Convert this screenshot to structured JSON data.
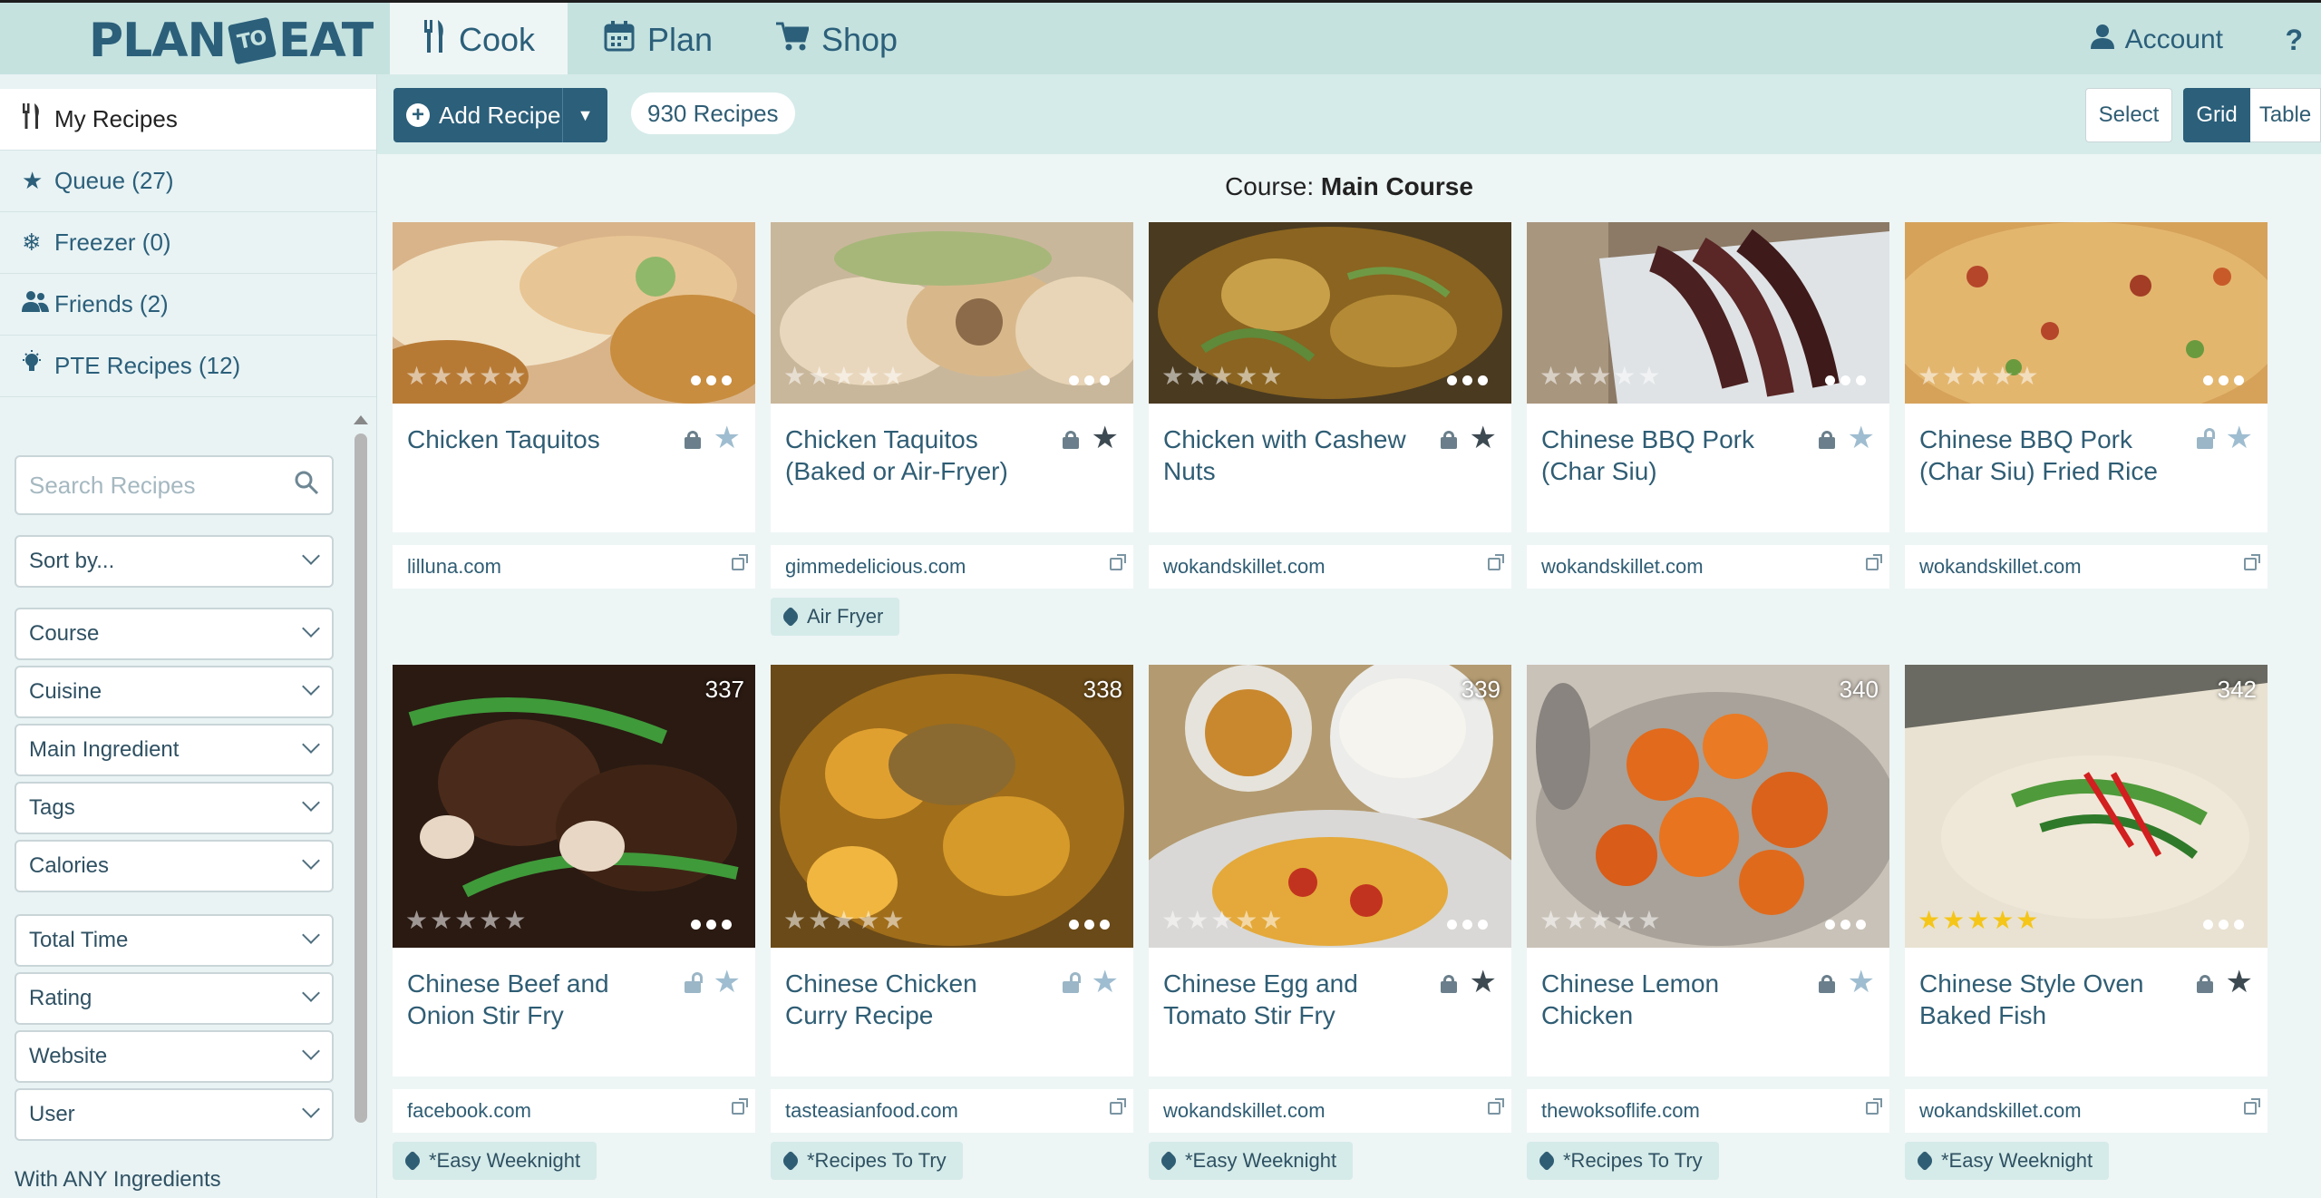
{
  "app": {
    "logo_left": "PLAN",
    "logo_mid": "TO",
    "logo_right": "EAT"
  },
  "nav": {
    "cook": "Cook",
    "plan": "Plan",
    "shop": "Shop",
    "account": "Account",
    "help": "?"
  },
  "sidebar": {
    "items": [
      {
        "label": "My Recipes",
        "icon": "fork-knife-icon"
      },
      {
        "label": "Queue (27)",
        "icon": "star-icon"
      },
      {
        "label": "Freezer (0)",
        "icon": "snowflake-icon"
      },
      {
        "label": "Friends (2)",
        "icon": "friends-icon"
      },
      {
        "label": "PTE Recipes (12)",
        "icon": "lightbulb-icon"
      }
    ],
    "search_placeholder": "Search Recipes",
    "filters": {
      "sort": "Sort by...",
      "course": "Course",
      "cuisine": "Cuisine",
      "main_ingredient": "Main Ingredient",
      "tags": "Tags",
      "calories": "Calories",
      "total_time": "Total Time",
      "rating": "Rating",
      "website": "Website",
      "user": "User"
    },
    "with_any": "With ANY Ingredients"
  },
  "toolbar": {
    "add_recipe": "Add Recipe",
    "recipe_count": "930 Recipes",
    "select": "Select",
    "grid": "Grid",
    "table": "Table"
  },
  "heading": {
    "prefix": "Course:",
    "value": "Main Course"
  },
  "recipes": [
    {
      "title": "Chicken Taquitos",
      "site": "lilluna.com",
      "number": "",
      "rating": 0,
      "lock": "locked",
      "starred": false,
      "tag": ""
    },
    {
      "title": "Chicken Taquitos (Baked or Air-Fryer)",
      "site": "gimmedelicious.com",
      "number": "",
      "rating": 0,
      "lock": "locked",
      "starred": true,
      "tag": "Air Fryer"
    },
    {
      "title": "Chicken with Cashew Nuts",
      "site": "wokandskillet.com",
      "number": "",
      "rating": 0,
      "lock": "locked",
      "starred": true,
      "tag": ""
    },
    {
      "title": "Chinese BBQ Pork (Char Siu)",
      "site": "wokandskillet.com",
      "number": "",
      "rating": 0,
      "lock": "locked",
      "starred": false,
      "tag": ""
    },
    {
      "title": "Chinese BBQ Pork (Char Siu) Fried Rice",
      "site": "wokandskillet.com",
      "number": "",
      "rating": 0,
      "lock": "unlocked",
      "starred": false,
      "tag": ""
    },
    {
      "title": "Chinese Beef and Onion Stir Fry",
      "site": "facebook.com",
      "number": "337",
      "rating": 0,
      "lock": "unlocked",
      "starred": false,
      "tag": "*Easy Weeknight"
    },
    {
      "title": "Chinese Chicken Curry Recipe",
      "site": "tasteasianfood.com",
      "number": "338",
      "rating": 0,
      "lock": "unlocked",
      "starred": false,
      "tag": "*Recipes To Try"
    },
    {
      "title": "Chinese Egg and Tomato Stir Fry",
      "site": "wokandskillet.com",
      "number": "339",
      "rating": 0,
      "lock": "locked",
      "starred": true,
      "tag": "*Easy Weeknight"
    },
    {
      "title": "Chinese Lemon Chicken",
      "site": "thewoksoflife.com",
      "number": "340",
      "rating": 0,
      "lock": "locked",
      "starred": false,
      "tag": "*Recipes To Try"
    },
    {
      "title": "Chinese Style Oven Baked Fish",
      "site": "wokandskillet.com",
      "number": "342",
      "rating": 5,
      "lock": "locked",
      "starred": true,
      "tag": "*Easy Weeknight"
    }
  ],
  "colors": {
    "brand": "#2b5f7a",
    "header_bg": "#c5e2df",
    "star_gold": "#f5c518"
  }
}
